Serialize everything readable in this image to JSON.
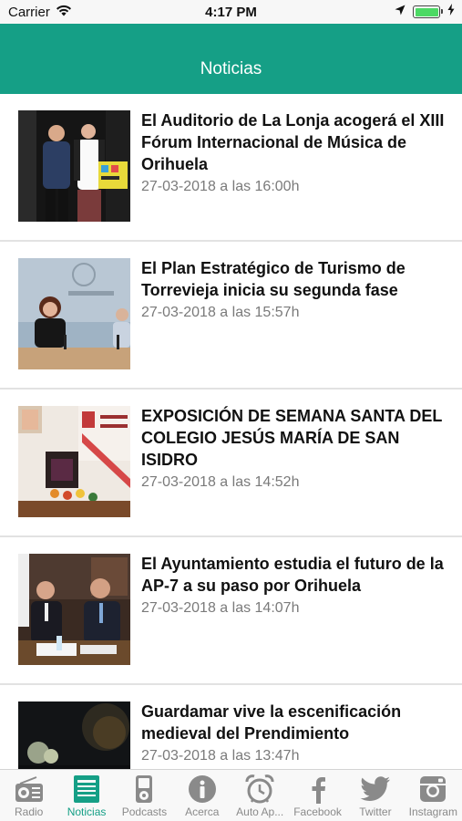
{
  "status": {
    "carrier": "Carrier",
    "time": "4:17 PM"
  },
  "nav": {
    "title": "Noticias"
  },
  "news": [
    {
      "title": "El Auditorio de La Lonja acogerá el XIII Fórum Internacional de Música de Orihuela",
      "date": "27-03-2018 a las 16:00h"
    },
    {
      "title": "El Plan Estratégico de Turismo de Torrevieja inicia su segunda fase",
      "date": "27-03-2018 a las 15:57h"
    },
    {
      "title": "EXPOSICIÓN DE SEMANA SANTA DEL COLEGIO JESÚS MARÍA DE SAN ISIDRO",
      "date": "27-03-2018 a las 14:52h"
    },
    {
      "title": "El Ayuntamiento estudia el futuro de la AP-7 a su paso por Orihuela",
      "date": "27-03-2018 a las 14:07h"
    },
    {
      "title": "Guardamar vive la escenificación medieval del Prendimiento",
      "date": "27-03-2018 a las 13:47h"
    }
  ],
  "tabs": [
    {
      "label": "Radio",
      "icon": "radio-icon"
    },
    {
      "label": "Noticias",
      "icon": "newspaper-icon",
      "active": true
    },
    {
      "label": "Podcasts",
      "icon": "ipod-icon"
    },
    {
      "label": "Acerca",
      "icon": "info-icon"
    },
    {
      "label": "Auto Ap...",
      "icon": "alarm-clock-icon"
    },
    {
      "label": "Facebook",
      "icon": "facebook-icon"
    },
    {
      "label": "Twitter",
      "icon": "twitter-icon"
    },
    {
      "label": "Instagram",
      "icon": "instagram-icon"
    }
  ],
  "colors": {
    "accent": "#159f86",
    "inactive": "#8a8a8a"
  }
}
